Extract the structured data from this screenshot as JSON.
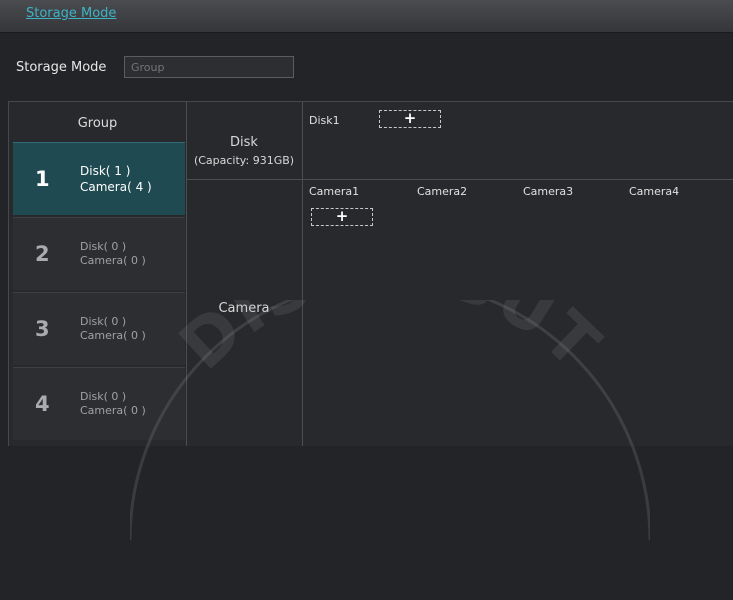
{
  "header": {
    "tab_label": "Storage Mode"
  },
  "storage_mode": {
    "label": "Storage Mode",
    "placeholder": "Group"
  },
  "groups": {
    "header": "Group",
    "items": [
      {
        "number": "1",
        "disk": "Disk( 1 )",
        "camera": "Camera( 4 )",
        "selected": true
      },
      {
        "number": "2",
        "disk": "Disk( 0 )",
        "camera": "Camera( 0 )",
        "selected": false
      },
      {
        "number": "3",
        "disk": "Disk( 0 )",
        "camera": "Camera( 0 )",
        "selected": false
      },
      {
        "number": "4",
        "disk": "Disk( 0 )",
        "camera": "Camera( 0 )",
        "selected": false
      }
    ]
  },
  "types": {
    "disk": {
      "label": "Disk",
      "capacity": "(Capacity: 931GB)"
    },
    "camera": {
      "label": "Camera"
    }
  },
  "disks": {
    "items": [
      "Disk1"
    ],
    "add_symbol": "+"
  },
  "cameras": {
    "items": [
      "Camera1",
      "Camera2",
      "Camera3",
      "Camera4"
    ],
    "add_symbol": "+"
  },
  "watermark": {
    "text": "DISTRIBUT"
  },
  "colors": {
    "accent": "#3fb3c6",
    "selected_bg": "#1f4a52",
    "background": "#232427"
  }
}
